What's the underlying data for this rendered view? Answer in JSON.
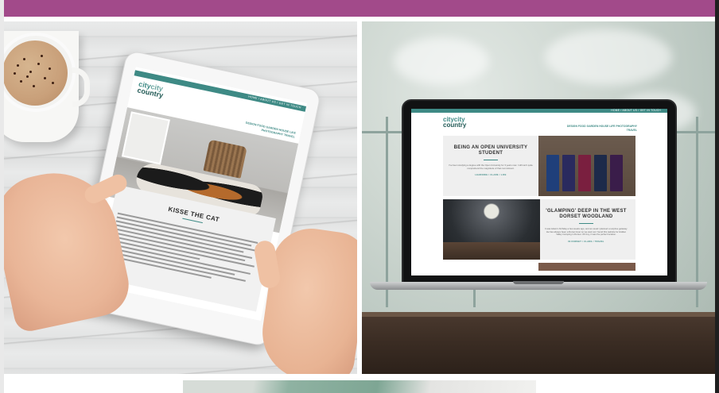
{
  "colors": {
    "accent_bar": "#a24a8a",
    "site_teal": "#3e8a85",
    "site_dark_teal": "#225a56"
  },
  "tablet_site": {
    "logo_city": "city",
    "logo_city2": "city",
    "logo_country": "country",
    "nav": "HOME  /  ABOUT US  /  GET IN TOUCH",
    "menu": "DESIGN  FOOD  GARDEN  HOUSE   LIFE  PHOTOGRAPHY  TRAVEL",
    "post_title": "KISSE THE CAT"
  },
  "laptop_site": {
    "logo_city": "city",
    "logo_city2": "city",
    "logo_country": "country",
    "nav": "HOME  /  ABOUT US  /  GET IN TOUCH",
    "menu": "DESIGN  FOOD  GARDEN  HOUSE   LIFE  PHOTOGRAPHY  TRAVEL",
    "posts": [
      {
        "title": "BEING AN OPEN UNIVERSITY STUDENT",
        "excerpt": "I've been studying a degree with the Open University for 3 years now. I still can't quite comprehend the magnitude of that commitment.",
        "meta": "LEARNING / CLARE / LIFE"
      },
      {
        "title": "'GLAMPING' DEEP IN THE WEST DORSET WOODLAND",
        "excerpt": "It was Adam's birthday a few weeks ago, and as usual I planned a surprise getaway. He has always been a Dorset lover so we went as I found this website for Hidden Valley Camping in Dorset. Oh boy, it was the perfect location.",
        "meta": "IN DORSET / CLARE / TRAVEL"
      }
    ]
  }
}
